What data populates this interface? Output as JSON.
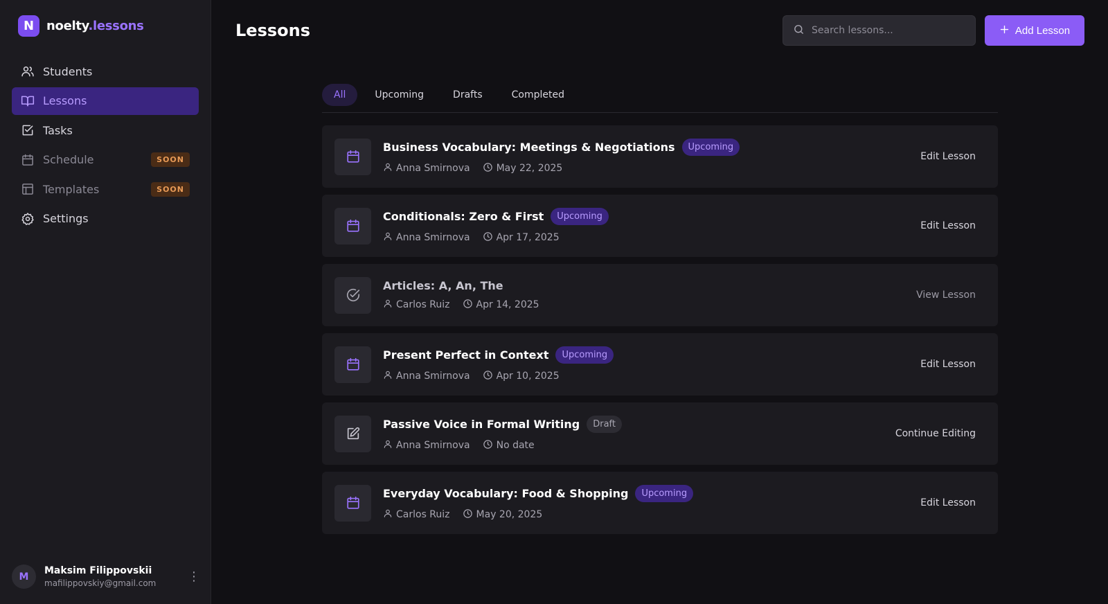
{
  "brand": {
    "logo_letter": "N",
    "name": "noelty",
    "suffix": ".lessons"
  },
  "sidebar": {
    "items": [
      {
        "label": "Students",
        "icon": "users-icon"
      },
      {
        "label": "Lessons",
        "icon": "book-icon",
        "active": true
      },
      {
        "label": "Tasks",
        "icon": "checkbox-icon"
      },
      {
        "label": "Schedule",
        "icon": "calendar-icon",
        "badge": "SOON"
      },
      {
        "label": "Templates",
        "icon": "layout-icon",
        "badge": "SOON"
      },
      {
        "label": "Settings",
        "icon": "gear-icon"
      }
    ]
  },
  "user": {
    "initial": "M",
    "name": "Maksim Filippovskii",
    "email": "mafilippovskiy@gmail.com"
  },
  "header": {
    "title": "Lessons",
    "search_placeholder": "Search lessons...",
    "add_label": "Add Lesson"
  },
  "tabs": [
    {
      "label": "All",
      "active": true
    },
    {
      "label": "Upcoming"
    },
    {
      "label": "Drafts"
    },
    {
      "label": "Completed"
    }
  ],
  "lessons": [
    {
      "title": "Business Vocabulary: Meetings & Negotiations",
      "status": "Upcoming",
      "student": "Anna Smirnova",
      "date": "May 22, 2025",
      "action": "Edit Lesson",
      "icon": "calendar-icon"
    },
    {
      "title": "Conditionals: Zero & First",
      "status": "Upcoming",
      "student": "Anna Smirnova",
      "date": "Apr 17, 2025",
      "action": "Edit Lesson",
      "icon": "calendar-icon"
    },
    {
      "title": "Articles: A, An, The",
      "status": "",
      "student": "Carlos Ruiz",
      "date": "Apr 14, 2025",
      "action": "View Lesson",
      "icon": "check-circle-icon"
    },
    {
      "title": "Present Perfect in Context",
      "status": "Upcoming",
      "student": "Anna Smirnova",
      "date": "Apr 10, 2025",
      "action": "Edit Lesson",
      "icon": "calendar-icon"
    },
    {
      "title": "Passive Voice in Formal Writing",
      "status": "Draft",
      "student": "Anna Smirnova",
      "date": "No date",
      "action": "Continue Editing",
      "icon": "edit-icon"
    },
    {
      "title": "Everyday Vocabulary: Food & Shopping",
      "status": "Upcoming",
      "student": "Carlos Ruiz",
      "date": "May 20, 2025",
      "action": "Edit Lesson",
      "icon": "calendar-icon"
    }
  ],
  "colors": {
    "accent": "#8b5cf6",
    "background": "#111014",
    "sidebar": "#1c1b20",
    "soon_badge": "#e89a56"
  }
}
